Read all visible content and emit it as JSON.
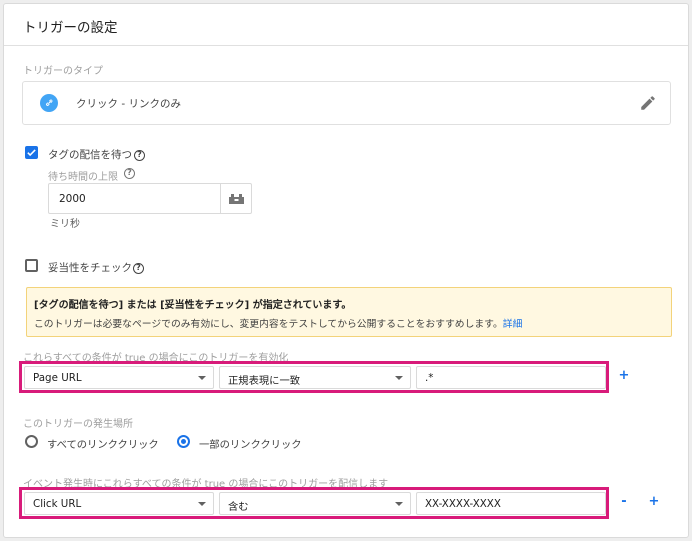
{
  "panel": {
    "title": "トリガーの設定",
    "trigger_type_label": "トリガーのタイプ",
    "trigger_type_value": "クリック - リンクのみ"
  },
  "wait_for_tags": {
    "checked": true,
    "label": "タグの配信を待つ",
    "max_wait_label": "待ち時間の上限",
    "max_wait_value": "2000",
    "unit": "ミリ秒"
  },
  "check_validation": {
    "checked": false,
    "label": "妥当性をチェック"
  },
  "notice": {
    "title": "[タグの配信を待つ] または [妥当性をチェック] が指定されています。",
    "body": "このトリガーは必要なページでのみ有効にし、変更内容をテストしてから公開することをおすすめします。",
    "link": "詳細"
  },
  "enable_conditions": {
    "label": "これらすべての条件が true の場合にこのトリガーを有効化",
    "variable": "Page URL",
    "operator": "正規表現に一致",
    "value": ".*",
    "add": "+"
  },
  "fires_on": {
    "label": "このトリガーの発生場所",
    "options": [
      {
        "label": "すべてのリンククリック",
        "selected": false
      },
      {
        "label": "一部のリンククリック",
        "selected": true
      }
    ]
  },
  "fire_conditions": {
    "label": "イベント発生時にこれらすべての条件が true の場合にこのトリガーを配信します",
    "variable": "Click URL",
    "operator": "含む",
    "value": "XX-XXXX-XXXX",
    "remove": "-",
    "add": "+"
  },
  "colors": {
    "accent": "#1a73e8",
    "highlight_border": "#d81b7a",
    "notice_bg": "#fff8e1"
  }
}
